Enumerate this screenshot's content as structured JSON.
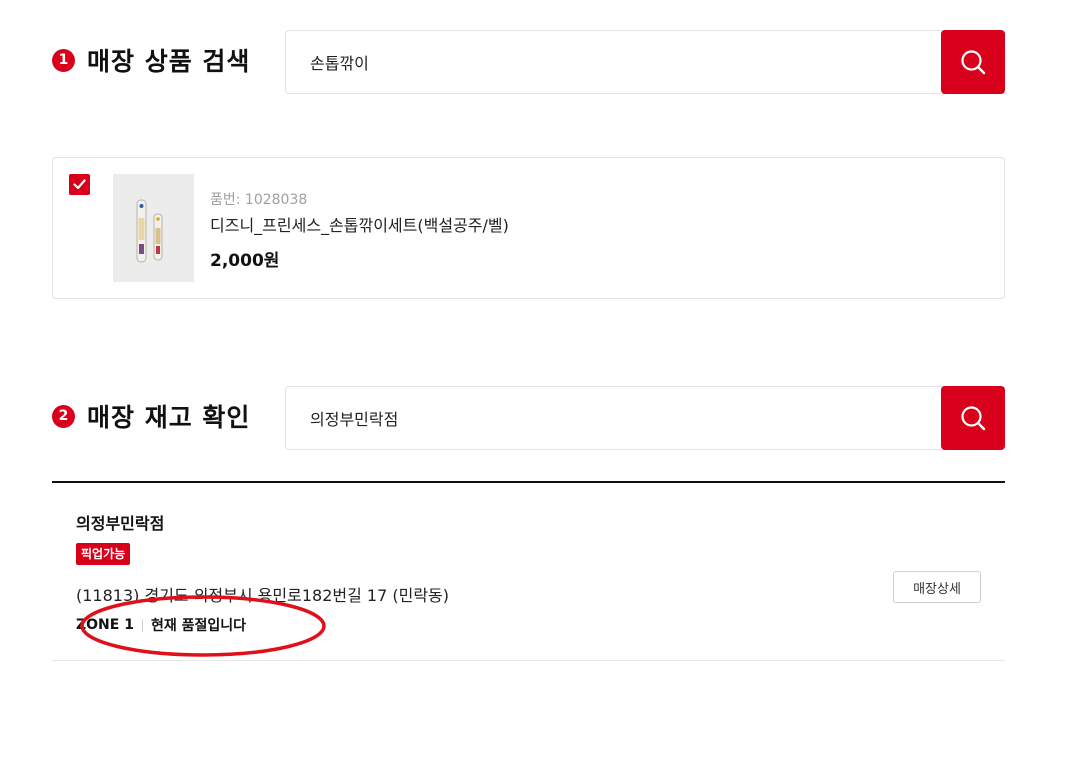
{
  "section1": {
    "number": "1",
    "title": "매장 상품 검색",
    "search_value": "손톱깎이"
  },
  "product": {
    "code": "품번: 1028038",
    "name": "디즈니_프린세스_손톱깎이세트(백설공주/벨)",
    "price": "2,000원",
    "checked": true
  },
  "section2": {
    "number": "2",
    "title": "매장 재고 확인",
    "search_value": "의정부민락점"
  },
  "store": {
    "name": "의정부민락점",
    "badge": "픽업가능",
    "address": "(11813) 경기도 의정부시 용민로182번길 17 (민락동)",
    "zone": "ZONE 1",
    "stock_status": "현재 품절입니다",
    "detail_button": "매장상세"
  },
  "colors": {
    "accent": "#d9001b",
    "annotation": "#e0101a"
  },
  "icons": {
    "search": "search-icon",
    "check": "check-icon"
  }
}
